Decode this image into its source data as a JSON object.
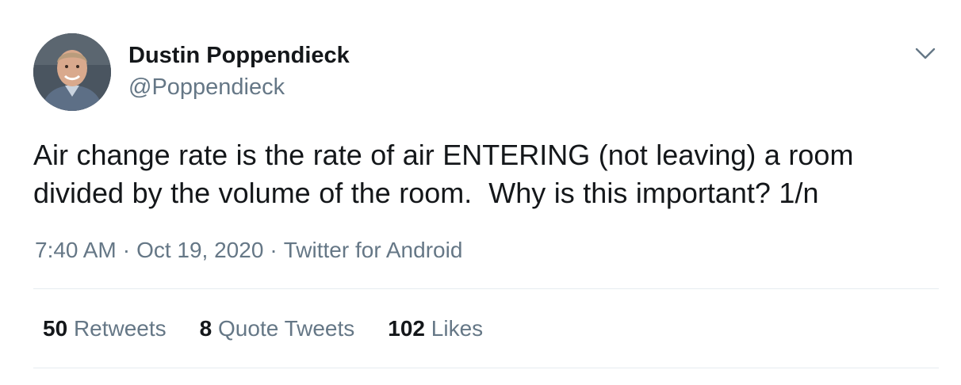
{
  "author": {
    "display_name": "Dustin Poppendieck",
    "handle": "@Poppendieck"
  },
  "tweet": {
    "text": "Air change rate is the rate of air ENTERING (not leaving) a room\ndivided by the volume of the room.  Why is this important? 1/n",
    "time": "7:40 AM",
    "date": "Oct 19, 2020",
    "separator": "·",
    "source": "Twitter for Android"
  },
  "stats": {
    "retweets_count": "50",
    "retweets_label": "Retweets",
    "quotes_count": "8",
    "quotes_label": "Quote Tweets",
    "likes_count": "102",
    "likes_label": "Likes"
  },
  "icons": {
    "menu": "chevron-down-icon"
  },
  "colors": {
    "primary_text": "#14171a",
    "secondary_text": "#657786",
    "divider": "#e6ecf0"
  }
}
